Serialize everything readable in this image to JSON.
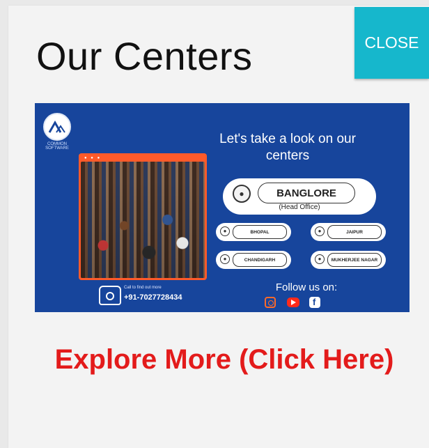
{
  "modal": {
    "title": "Our Centers",
    "close_label": "CLOSE"
  },
  "banner": {
    "headline": "Let's take a look on our centers",
    "head_office": {
      "name": "BANGLORE",
      "sub": "(Head Office)"
    },
    "centers": [
      "BHOPAL",
      "JAIPUR",
      "CHANDIGARH",
      "MUKHERJEE NAGAR"
    ],
    "logo_caption": "COMMON SOFTWARE",
    "contact": {
      "label": "Call to find out more",
      "phone": "+91-7027728434"
    },
    "follow_label": "Follow us on:",
    "social_icons": [
      "instagram-icon",
      "youtube-icon",
      "facebook-icon"
    ]
  },
  "link": {
    "explore_label": "Explore More (Click Here)"
  },
  "colors": {
    "accent": "#16b7cc",
    "banner_bg": "#17459c",
    "link": "#e31b1b",
    "photo_frame": "#ff5a2a"
  }
}
